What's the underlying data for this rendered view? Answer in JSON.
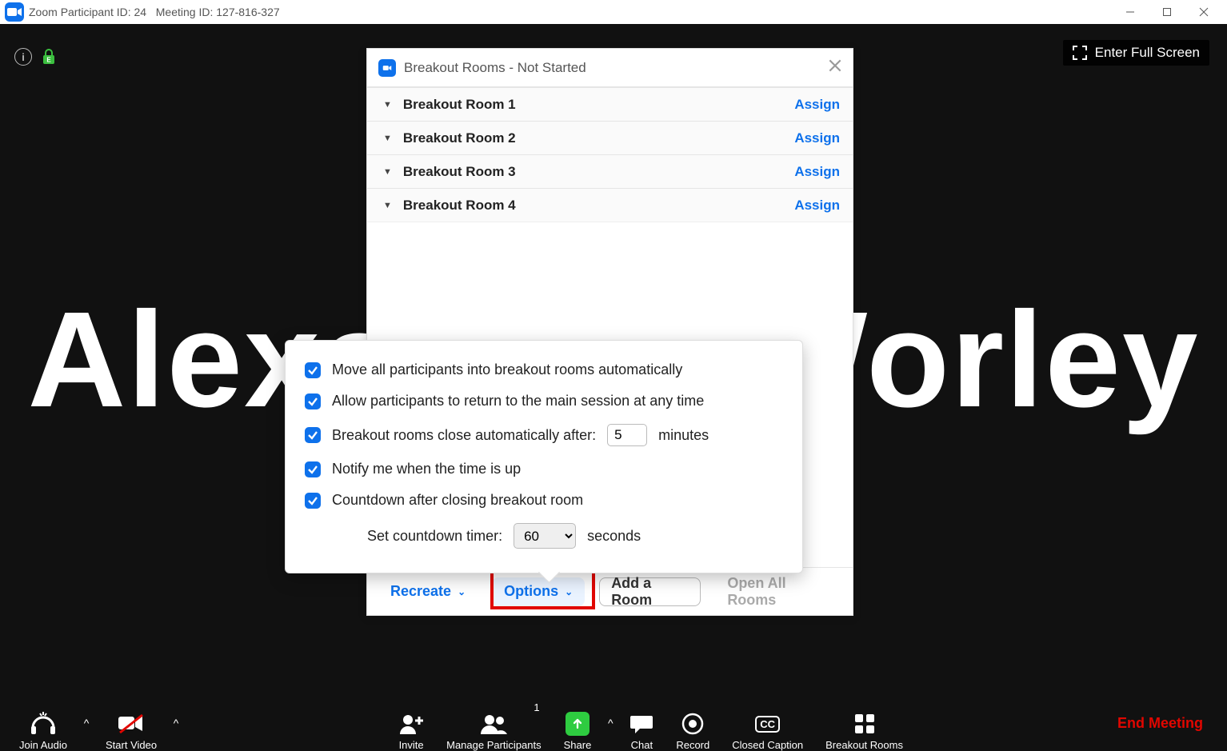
{
  "titlebar": {
    "app": "Zoom",
    "participant_label": "Participant ID:",
    "participant_id": "24",
    "meeting_label": "Meeting ID:",
    "meeting_id": "127-816-327"
  },
  "stage": {
    "display_name": "Alexander Worley",
    "fullscreen_label": "Enter Full Screen"
  },
  "breakout": {
    "title": "Breakout Rooms - Not Started",
    "assign_label": "Assign",
    "rooms": [
      {
        "name": "Breakout Room 1"
      },
      {
        "name": "Breakout Room 2"
      },
      {
        "name": "Breakout Room 3"
      },
      {
        "name": "Breakout Room 4"
      }
    ],
    "footer": {
      "recreate": "Recreate",
      "options": "Options",
      "add_room": "Add a Room",
      "open_all": "Open All Rooms"
    }
  },
  "options": {
    "opt1": "Move all participants into breakout rooms automatically",
    "opt2": "Allow participants to return to the main session at any time",
    "opt3_pre": "Breakout rooms close automatically after:",
    "opt3_value": "5",
    "opt3_post": "minutes",
    "opt4": "Notify me when the time is up",
    "opt5": "Countdown after closing breakout room",
    "countdown_label": "Set countdown timer:",
    "countdown_value": "60",
    "countdown_unit": "seconds"
  },
  "toolbar": {
    "join_audio": "Join Audio",
    "start_video": "Start Video",
    "invite": "Invite",
    "manage_participants": "Manage Participants",
    "participant_count": "1",
    "share": "Share",
    "chat": "Chat",
    "record": "Record",
    "closed_caption": "Closed Caption",
    "breakout_rooms": "Breakout Rooms",
    "end_meeting": "End Meeting"
  }
}
